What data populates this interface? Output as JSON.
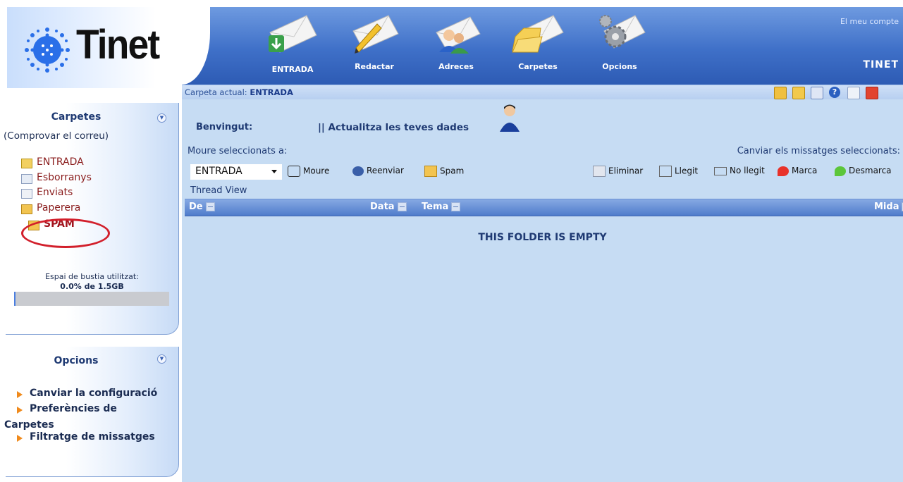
{
  "logo": {
    "text": "Tinet"
  },
  "nav": {
    "items": [
      {
        "label": "ENTRADA",
        "icon": "inbox-envelope-icon"
      },
      {
        "label": "Redactar",
        "icon": "compose-envelope-icon"
      },
      {
        "label": "Adreces",
        "icon": "address-book-envelope-icon"
      },
      {
        "label": "Carpetes",
        "icon": "folders-envelope-icon"
      },
      {
        "label": "Opcions",
        "icon": "options-envelope-icon"
      }
    ],
    "account_link": "El meu compte",
    "account_name": "TINET"
  },
  "subbar": {
    "current_folder_label": "Carpeta actual:",
    "current_folder": "ENTRADA"
  },
  "sidebar": {
    "folders_title": "Carpetes",
    "check_mail": "(Comprovar el correu)",
    "folders": [
      {
        "label": "ENTRADA",
        "icon": "inbox-folder-icon"
      },
      {
        "label": "Esborranys",
        "icon": "drafts-folder-icon"
      },
      {
        "label": "Enviats",
        "icon": "sent-folder-icon"
      },
      {
        "label": "Paperera",
        "icon": "trash-folder-icon"
      },
      {
        "label": "SPAM",
        "icon": "spam-folder-icon"
      }
    ],
    "quota_label": "Espai de bustia utilitzat:",
    "quota_value": "0.0% de 1.5GB",
    "quota_fraction": 0.0,
    "options_title": "Opcions",
    "options": [
      {
        "label": "Canviar la configuració"
      },
      {
        "label": "Preferències de"
      },
      {
        "label": "Carpetes"
      },
      {
        "label": "Filtratge de missatges"
      }
    ]
  },
  "main": {
    "welcome": "Benvingut:",
    "update_data": "|| Actualitza les teves dades",
    "move_label": "Moure seleccionats a:",
    "move_select_value": "ENTRADA",
    "move_button": "Moure",
    "forward_button": "Reenviar",
    "spam_button": "Spam",
    "change_label": "Canviar els missatges seleccionats:",
    "delete_button": "Eliminar",
    "read_button": "Llegit",
    "unread_button": "No llegit",
    "flag_button": "Marca",
    "unflag_button": "Desmarca",
    "thread_view": "Thread View",
    "columns": {
      "from": "De",
      "date": "Data",
      "subject": "Tema",
      "size": "Mida"
    },
    "empty_message": "THIS FOLDER IS EMPTY"
  },
  "colors": {
    "nav_blue": "#3f70c8",
    "main_bg": "#c6dcf3",
    "folder_text": "#8a1c1c",
    "spam_circle": "#d21f2b"
  }
}
